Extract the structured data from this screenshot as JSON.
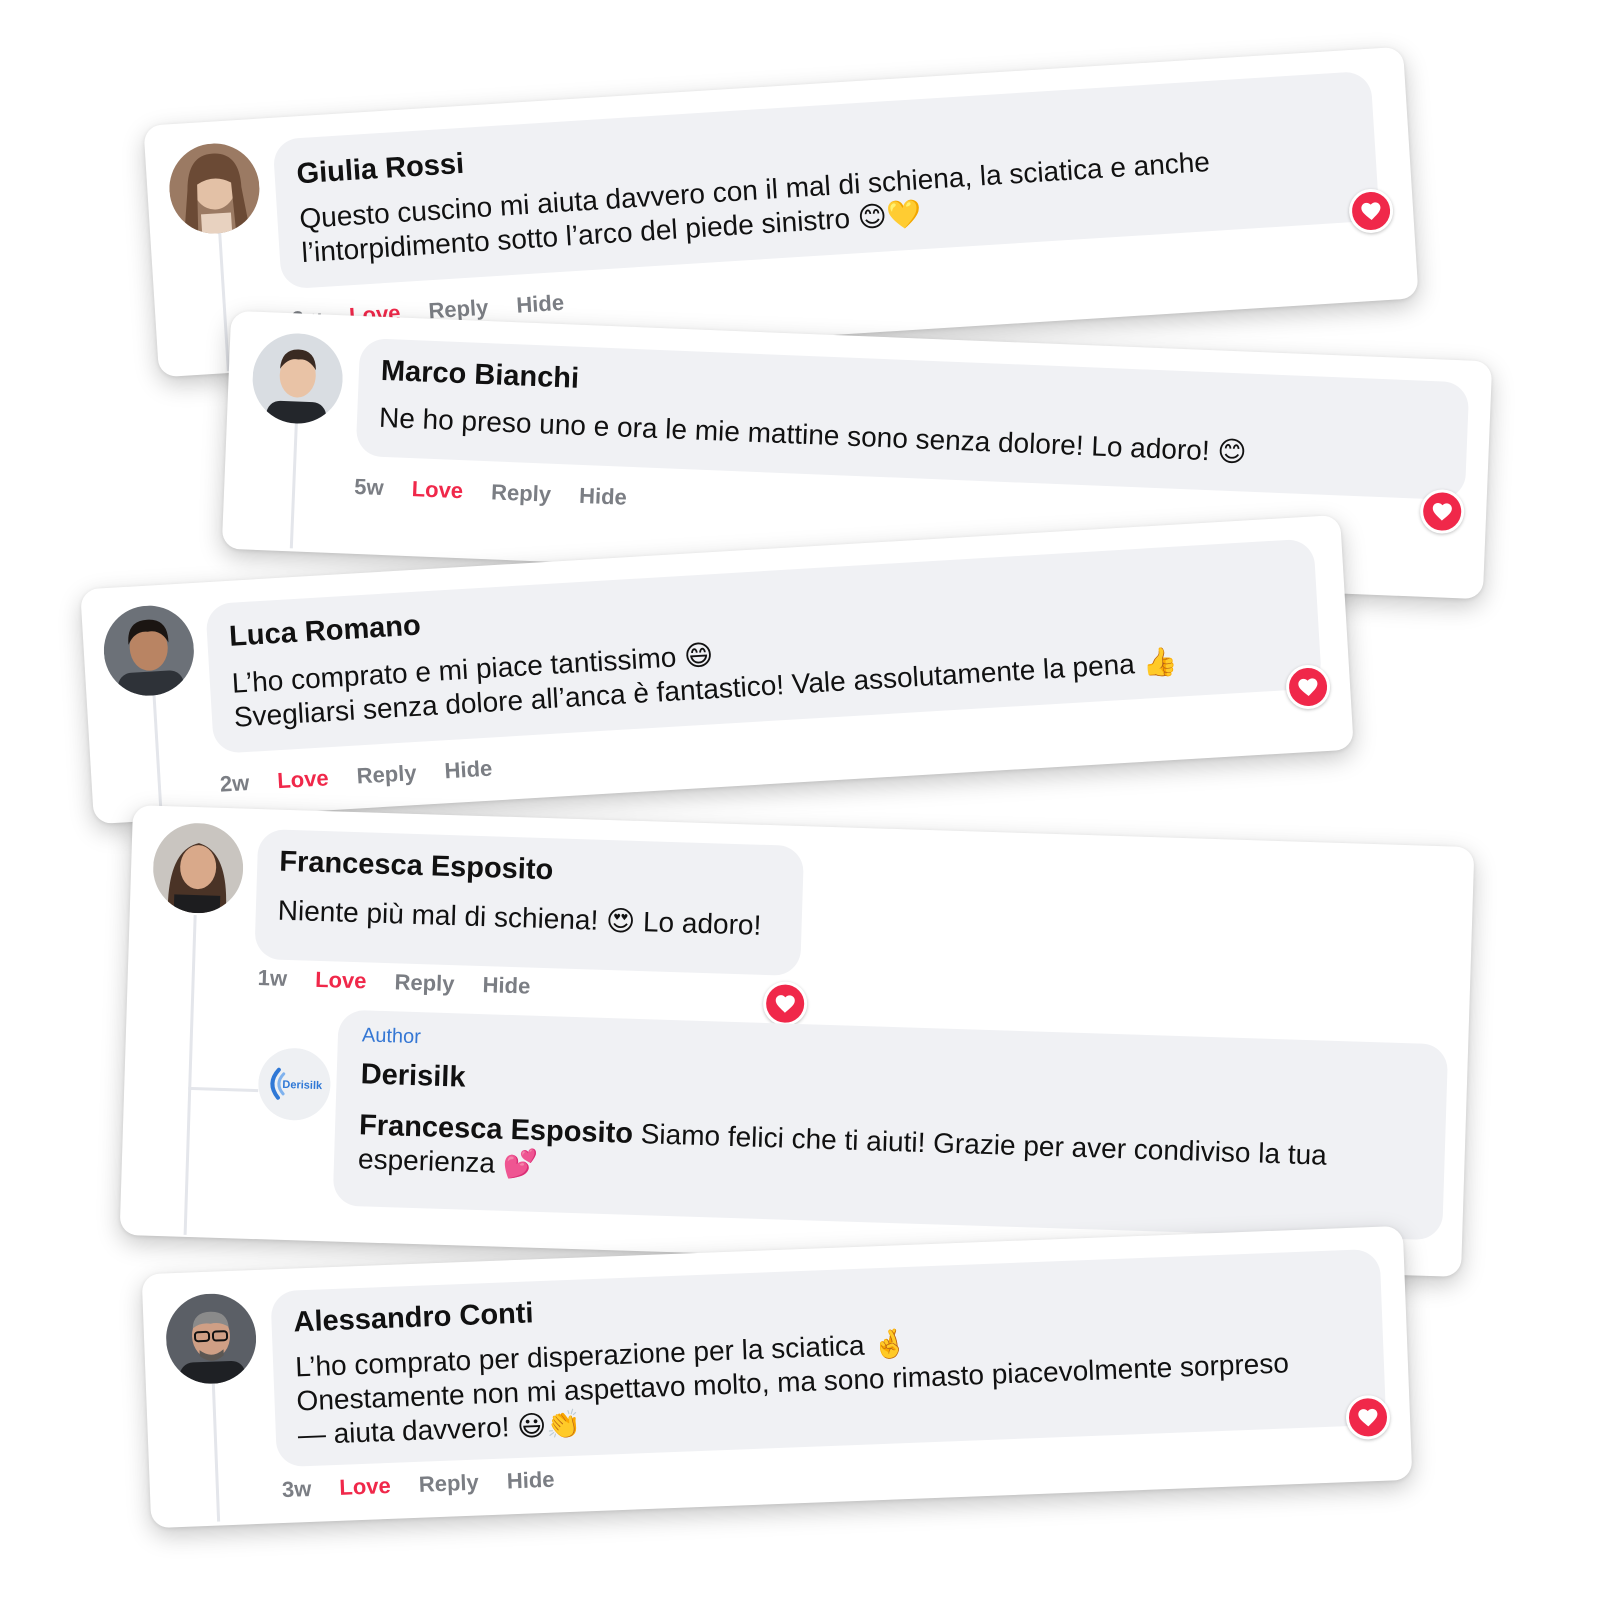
{
  "comments": [
    {
      "name": "Giulia Rossi",
      "lines": [
        "Questo cuscino mi aiuta davvero con il mal di schiena, la sciatica e anche",
        "l’intorpidimento sotto l’arco del piede sinistro 😊💛"
      ],
      "time": "3w",
      "love": "Love",
      "reply": "Reply",
      "hide": "Hide"
    },
    {
      "name": "Marco Bianchi",
      "lines": [
        "Ne ho preso uno e ora le mie mattine sono senza dolore! Lo adoro! 😊"
      ],
      "time": "5w",
      "love": "Love",
      "reply": "Reply",
      "hide": "Hide"
    },
    {
      "name": "Luca Romano",
      "lines": [
        "L’ho comprato e mi piace tantissimo 😄",
        "Svegliarsi senza dolore all’anca è fantastico! Vale assolutamente la pena 👍"
      ],
      "time": "2w",
      "love": "Love",
      "reply": "Reply",
      "hide": "Hide"
    },
    {
      "name": "Francesca Esposito",
      "lines": [
        "Niente più mal di schiena! 😍 Lo adoro!"
      ],
      "time": "1w",
      "love": "Love",
      "reply": "Reply",
      "hide": "Hide",
      "reply_comment": {
        "tag": "Author",
        "name": "Derisilk",
        "logo_text": "Derisilk",
        "mention": "Francesca Esposito",
        "line1": " Siamo felici che ti aiuti! Grazie per aver condiviso la tua",
        "line2": "esperienza 💕"
      }
    },
    {
      "name": "Alessandro Conti",
      "lines": [
        "L’ho comprato per disperazione per la sciatica 🤞",
        "Onestamente non mi aspettavo molto, ma sono rimasto piacevolmente sorpreso",
        "— aiuta davvero! 😃👏"
      ],
      "time": "3w",
      "love": "Love",
      "reply": "Reply",
      "hide": "Hide"
    }
  ],
  "colors": {
    "love": "#f0284a",
    "bubble": "#f0f1f4",
    "author": "#3577d4"
  },
  "icons": {
    "reaction": "heart-icon"
  }
}
